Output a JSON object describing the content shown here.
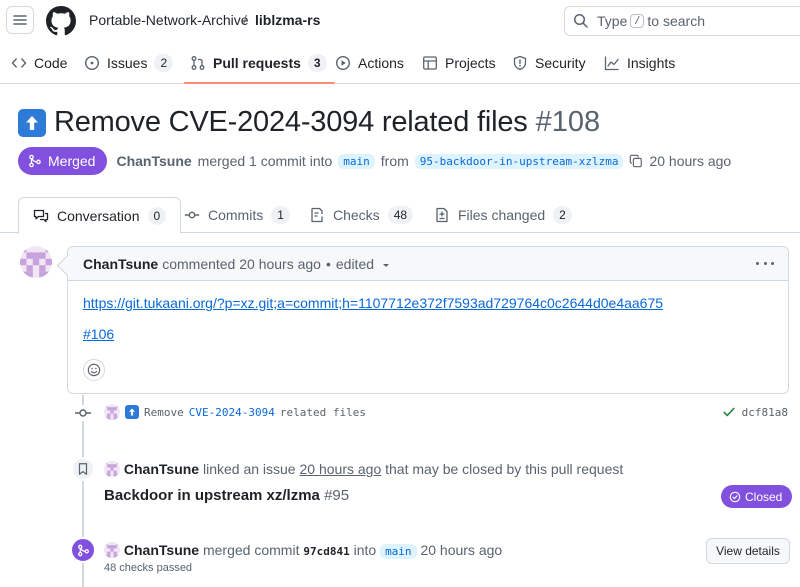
{
  "header": {
    "owner": "Portable-Network-Archive",
    "separator": "/",
    "repo": "liblzma-rs",
    "search_prefix": "Type",
    "search_key": "/",
    "search_suffix": "to search"
  },
  "repo_nav": [
    {
      "label": "Code",
      "icon": "code-icon"
    },
    {
      "label": "Issues",
      "count": "2",
      "icon": "issue-icon"
    },
    {
      "label": "Pull requests",
      "count": "3",
      "icon": "pull-request-icon"
    },
    {
      "label": "Actions",
      "icon": "play-icon"
    },
    {
      "label": "Projects",
      "icon": "table-icon"
    },
    {
      "label": "Security",
      "icon": "shield-icon"
    },
    {
      "label": "Insights",
      "icon": "graph-icon"
    }
  ],
  "pr": {
    "title": "Remove CVE-2024-3094 related files",
    "number": "#108",
    "state": "Merged",
    "author": "ChanTsune",
    "action": "merged 1 commit into",
    "base": "main",
    "from": "from",
    "head": "95-backdoor-in-upstream-xzlzma",
    "time": "20 hours ago"
  },
  "tabs": [
    {
      "label": "Conversation",
      "count": "0"
    },
    {
      "label": "Commits",
      "count": "1"
    },
    {
      "label": "Checks",
      "count": "48"
    },
    {
      "label": "Files changed",
      "count": "2"
    }
  ],
  "comment": {
    "author": "ChanTsune",
    "meta": "commented 20 hours ago",
    "bullet": "•",
    "edited": "edited",
    "link": "https://git.tukaani.org/?p=xz.git;a=commit;h=1107712e372f7593ad729764c0c2644d0e4aa675",
    "ref": "#106"
  },
  "timeline": {
    "commit": {
      "prefix": "Remove",
      "code": "CVE-2024-3094",
      "suffix": "related files",
      "sha": "dcf81a8"
    },
    "linked": {
      "author": "ChanTsune",
      "text1": "linked an issue",
      "time": "20 hours ago",
      "text2": "that may be closed by this pull request",
      "issue_title": "Backdoor in upstream xz/lzma",
      "issue_num": "#95",
      "issue_state": "Closed"
    },
    "merged": {
      "author": "ChanTsune",
      "text1": "merged commit",
      "sha": "97cd841",
      "text2": "into",
      "branch": "main",
      "time": "20 hours ago",
      "checks": "48 checks passed",
      "button": "View details"
    }
  },
  "colors": {
    "merged": "#8250df",
    "link": "#0969da",
    "active_tab_underline": "#fd8c73",
    "success": "#1a7f37"
  }
}
